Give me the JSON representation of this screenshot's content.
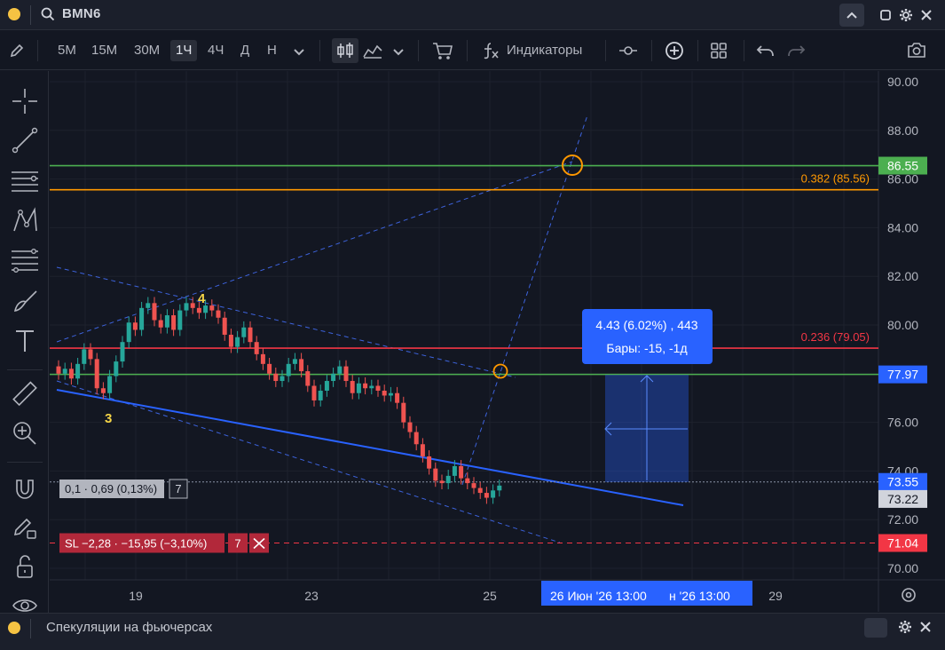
{
  "window": {
    "symbol": "BMN6"
  },
  "toolbar": {
    "timeframes": [
      "5М",
      "15М",
      "30М",
      "1Ч",
      "4Ч",
      "Д",
      "Н"
    ],
    "active_timeframe": "1Ч",
    "indicators_label": "Индикаторы"
  },
  "bottom": {
    "panel_label": "Спекуляции на фьючерсах"
  },
  "colors": {
    "accent": "#2962ff",
    "up": "#26a69a",
    "down": "#ef5350",
    "green_line": "#4caf50",
    "orange_line": "#ff9800",
    "red_line": "#f23645"
  },
  "chart_data": {
    "type": "candlestick",
    "ylim": [
      69.5,
      90.5
    ],
    "price_ticks": [
      "90.00",
      "88.00",
      "86.00",
      "84.00",
      "82.00",
      "80.00",
      "78.00",
      "76.00",
      "74.00",
      "72.00",
      "70.00"
    ],
    "x_ticks": [
      "19",
      "23",
      "25",
      "29"
    ],
    "wave_labels": [
      "3",
      "4"
    ],
    "levels": [
      {
        "name": "green-upper",
        "price": 86.55,
        "badge": "86.55",
        "color": "#4caf50"
      },
      {
        "name": "fib-0382",
        "price": 85.56,
        "label": "0.382 (85.56)",
        "color": "#ff9800"
      },
      {
        "name": "fib-0236",
        "price": 79.05,
        "label": "0.236 (79.05)",
        "color": "#f23645"
      },
      {
        "name": "green-lower",
        "price": 77.97,
        "badge": "77.97",
        "color": "#4caf50"
      },
      {
        "name": "stop-loss",
        "price": 71.04,
        "badge": "71.04",
        "color": "#f23645"
      }
    ],
    "current_price": "73.55",
    "last_price": "73.22",
    "position_label": "0,1 · 0,69 (0,13%)",
    "position_qty": "7",
    "sl_label": "SL −2,28 · −15,95 (−3,10%)",
    "sl_qty": "7",
    "measure": {
      "line1": "4.43 (6.02%) , 443",
      "line2": "Бары: -15, -1д"
    },
    "crosshair_time": "26 Июн '26     13:00",
    "crosshair_time_right": "н '26     13:00",
    "candles_close": [
      78.0,
      78.2,
      77.8,
      78.4,
      79.0,
      78.6,
      77.4,
      77.2,
      77.9,
      78.5,
      79.3,
      80.1,
      79.8,
      80.7,
      80.9,
      80.2,
      79.9,
      80.4,
      79.8,
      80.6,
      80.9,
      80.7,
      80.5,
      80.8,
      80.6,
      80.3,
      79.6,
      79.1,
      79.5,
      79.9,
      79.3,
      78.8,
      78.4,
      78.0,
      77.7,
      77.9,
      78.4,
      78.6,
      78.1,
      77.5,
      76.9,
      77.3,
      77.7,
      78.0,
      78.3,
      77.7,
      77.2,
      77.6,
      77.4,
      77.5,
      77.3,
      77.1,
      77.2,
      76.8,
      76.0,
      75.6,
      75.1,
      74.6,
      74.1,
      73.6,
      73.5,
      73.8,
      74.2,
      73.7,
      73.5,
      73.3,
      73.1,
      72.9,
      73.2,
      73.4
    ]
  }
}
